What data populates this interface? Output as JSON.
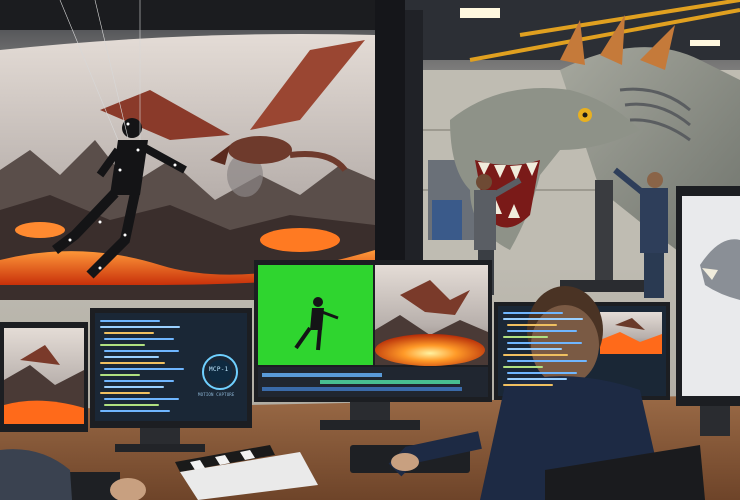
{
  "scene": {
    "description_tag": "visual-effects-studio",
    "monitor_text": {
      "mcp_badge": "MCP-1",
      "mcp_caption": "MOTION CAPTURE"
    },
    "colors": {
      "ceiling": "#2b2f36",
      "warehouse_wall": "#bdbab0",
      "desk_wood": "#8a5a3a",
      "lava": "#ff6a1a",
      "green_screen": "#2fd52f",
      "dragon_skin": "#8a8f86",
      "monitor_bezel": "#1c1e22",
      "screen_dark": "#1e2a38",
      "code_blue": "#6fb6ff",
      "sky": "#c9c4c0"
    }
  }
}
